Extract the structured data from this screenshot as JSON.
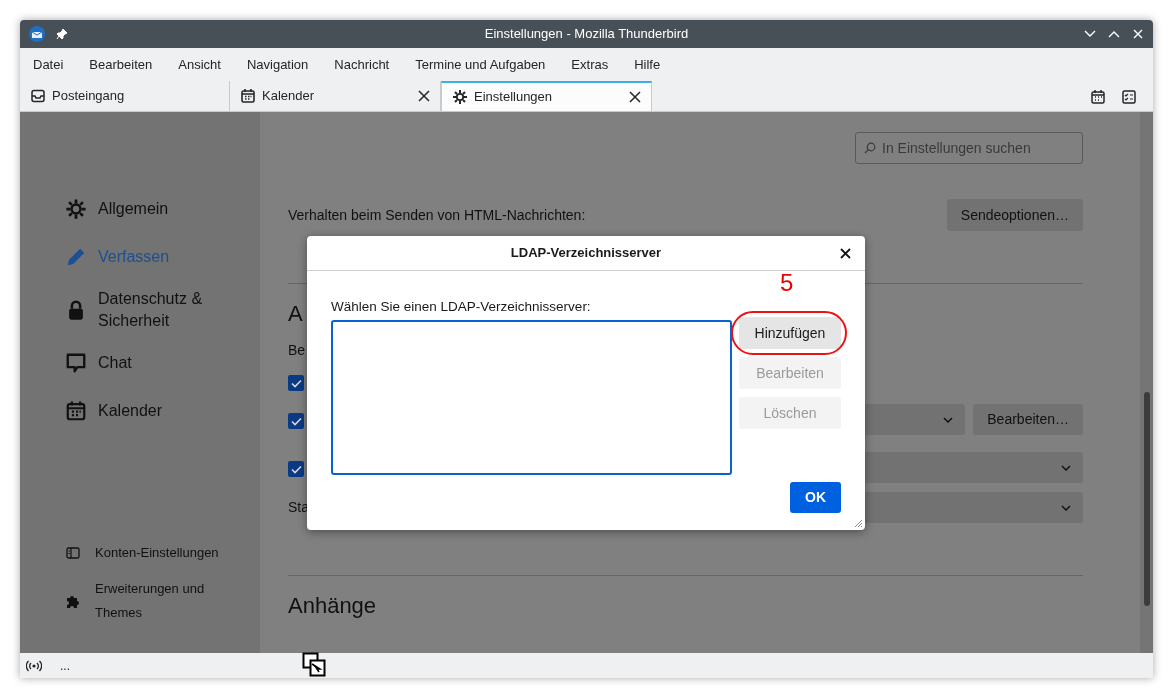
{
  "window": {
    "title": "Einstellungen - Mozilla Thunderbird"
  },
  "menu": [
    "Datei",
    "Bearbeiten",
    "Ansicht",
    "Navigation",
    "Nachricht",
    "Termine und Aufgaben",
    "Extras",
    "Hilfe"
  ],
  "tabs": [
    {
      "label": "Posteingang",
      "closable": false,
      "selected": false
    },
    {
      "label": "Kalender",
      "closable": true,
      "selected": false
    },
    {
      "label": "Einstellungen",
      "closable": true,
      "selected": true
    }
  ],
  "sidebar": {
    "items": [
      {
        "label": "Allgemein",
        "selected": false
      },
      {
        "label": "Verfassen",
        "selected": true
      },
      {
        "label": "Datenschutz & Sicherheit",
        "selected": false
      },
      {
        "label": "Chat",
        "selected": false
      },
      {
        "label": "Kalender",
        "selected": false
      }
    ],
    "footer_items": [
      {
        "label": "Konten-Einstellungen"
      },
      {
        "label": "Erweiterungen und Themes"
      }
    ]
  },
  "search": {
    "placeholder": "In Einstellungen suchen"
  },
  "compose": {
    "html_label": "Verhalten beim Senden von HTML-Nachrichten:",
    "send_options_button": "Sendeoptionen…",
    "section_heading": "A",
    "subheading": "Be",
    "checkboxes": [
      {
        "checked": true
      },
      {
        "checked": true
      },
      {
        "checked": true
      }
    ],
    "edit_button": "Bearbeiten…",
    "row_label": "Sta",
    "attachments_heading": "Anhänge"
  },
  "dialog": {
    "title": "LDAP-Verzeichnisserver",
    "list_label": "Wählen Sie einen LDAP-Verzeichnisserver:",
    "buttons": [
      {
        "label": "Hinzufügen",
        "disabled": false,
        "highlighted": true
      },
      {
        "label": "Bearbeiten",
        "disabled": true,
        "highlighted": false
      },
      {
        "label": "Löschen",
        "disabled": true,
        "highlighted": false
      }
    ],
    "ok_button": "OK"
  },
  "annotation": {
    "label": "5"
  },
  "status_bar": {
    "text": "..."
  }
}
